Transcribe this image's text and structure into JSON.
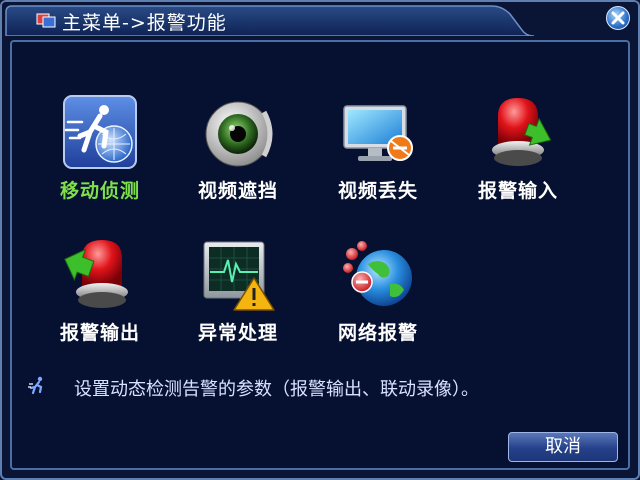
{
  "window": {
    "title": "主菜单->报警功能",
    "close_icon": "close-icon"
  },
  "menu": {
    "items": [
      {
        "label": "移动侦测",
        "icon": "motion-detect-icon",
        "selected": true
      },
      {
        "label": "视频遮挡",
        "icon": "video-blind-icon",
        "selected": false
      },
      {
        "label": "视频丢失",
        "icon": "video-loss-icon",
        "selected": false
      },
      {
        "label": "报警输入",
        "icon": "alarm-input-icon",
        "selected": false
      },
      {
        "label": "报警输出",
        "icon": "alarm-output-icon",
        "selected": false
      },
      {
        "label": "异常处理",
        "icon": "abnormality-icon",
        "selected": false
      },
      {
        "label": "网络报警",
        "icon": "network-alarm-icon",
        "selected": false
      }
    ]
  },
  "hint": {
    "text": "设置动态检测告警的参数（报警输出、联动录像）。",
    "icon": "runner-icon"
  },
  "footer": {
    "cancel_label": "取消"
  },
  "colors": {
    "selected_label": "#7fe04a",
    "background": "#061030",
    "border": "#4a6fa4"
  }
}
